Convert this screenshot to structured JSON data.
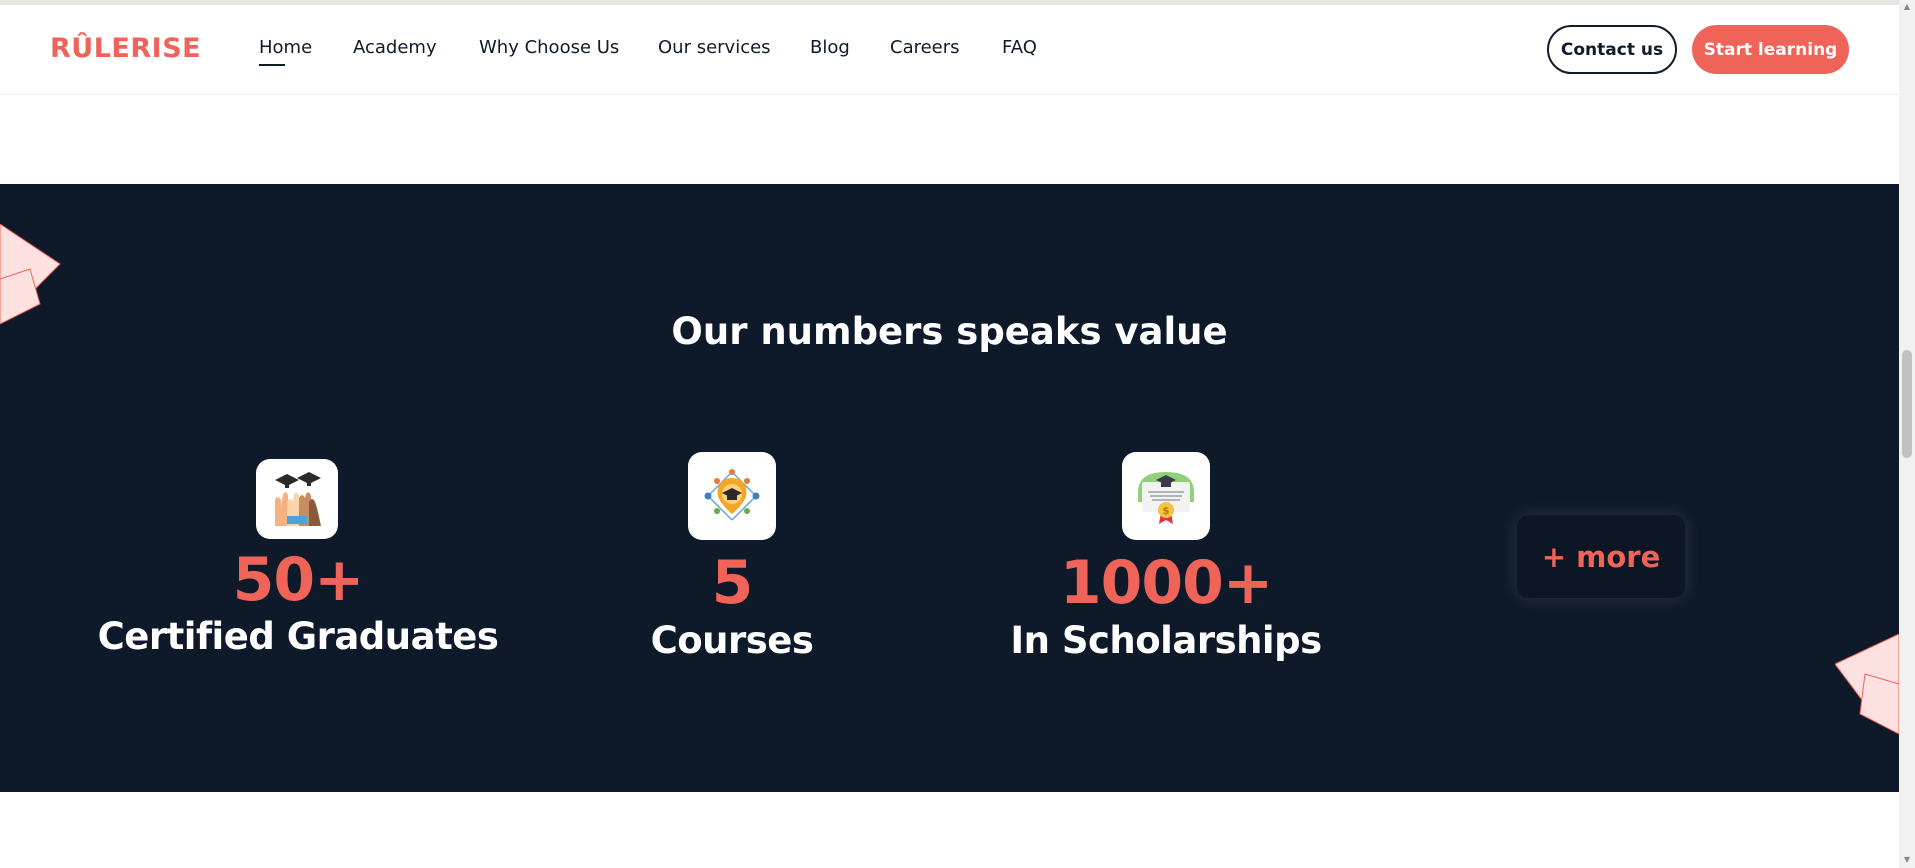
{
  "header": {
    "logo": "RÛLERISE",
    "nav": [
      {
        "label": "Home",
        "active": true
      },
      {
        "label": "Academy",
        "active": false
      },
      {
        "label": "Why Choose Us",
        "active": false
      },
      {
        "label": "Our services",
        "active": false
      },
      {
        "label": "Blog",
        "active": false
      },
      {
        "label": "Careers",
        "active": false
      },
      {
        "label": "FAQ",
        "active": false
      }
    ],
    "contact_label": "Contact us",
    "start_label": "Start learning"
  },
  "stats_section": {
    "title": "Our numbers speaks value",
    "items": [
      {
        "value": "50+",
        "label": "Certified Graduates",
        "icon": "graduation-hands-icon"
      },
      {
        "value": "5",
        "label": "Courses",
        "icon": "graduation-network-icon"
      },
      {
        "value": "1000+",
        "label": "In Scholarships",
        "icon": "scholarship-certificate-icon"
      }
    ],
    "more_label": "+ more"
  },
  "colors": {
    "brand": "#ef6359",
    "dark_bg": "#0e1a29",
    "text_dark": "#0f1a2a",
    "white": "#ffffff"
  }
}
